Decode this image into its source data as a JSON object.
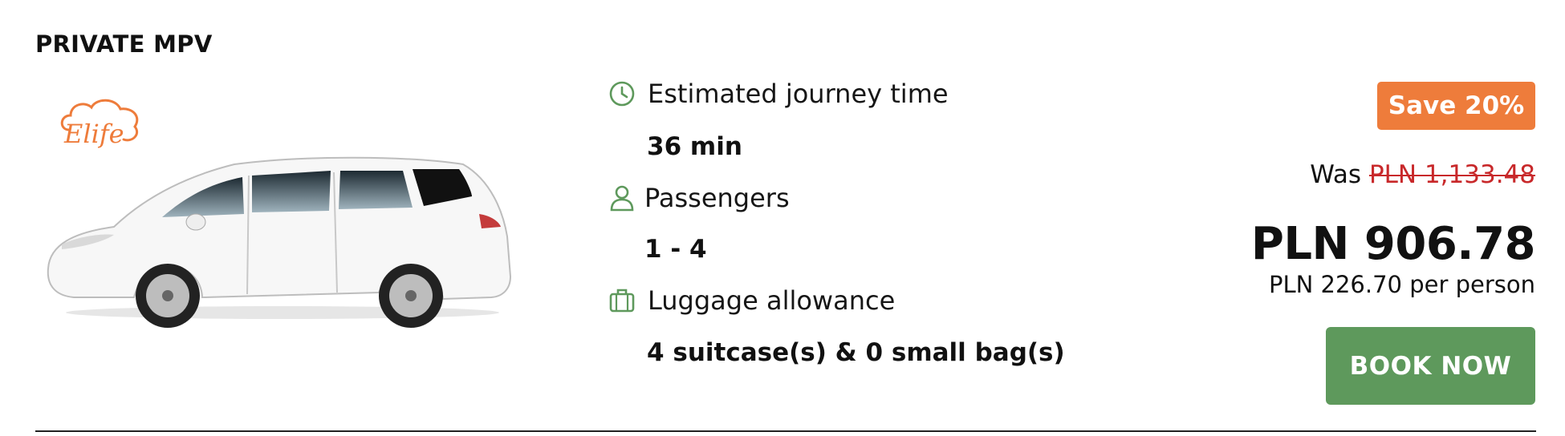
{
  "vehicle": {
    "title": "PRIVATE MPV",
    "logo_text": "Elife"
  },
  "details": {
    "journey": {
      "label": "Estimated journey time",
      "value": "36 min",
      "icon": "clock-icon"
    },
    "passengers": {
      "label": "Passengers",
      "value": "1 - 4",
      "icon": "person-icon"
    },
    "luggage": {
      "label": "Luggage allowance",
      "value": "4 suitcase(s) & 0 small bag(s)",
      "icon": "luggage-icon"
    }
  },
  "pricing": {
    "save_badge": "Save 20%",
    "was_label": "Was",
    "was_price": "PLN 1,133.48",
    "price": "PLN 906.78",
    "per_person": "PLN 226.70 per person"
  },
  "actions": {
    "book_label": "BOOK NOW"
  },
  "colors": {
    "accent_green": "#5e995c",
    "save_orange": "#ee7c3b",
    "strike_red": "#c8282a"
  }
}
